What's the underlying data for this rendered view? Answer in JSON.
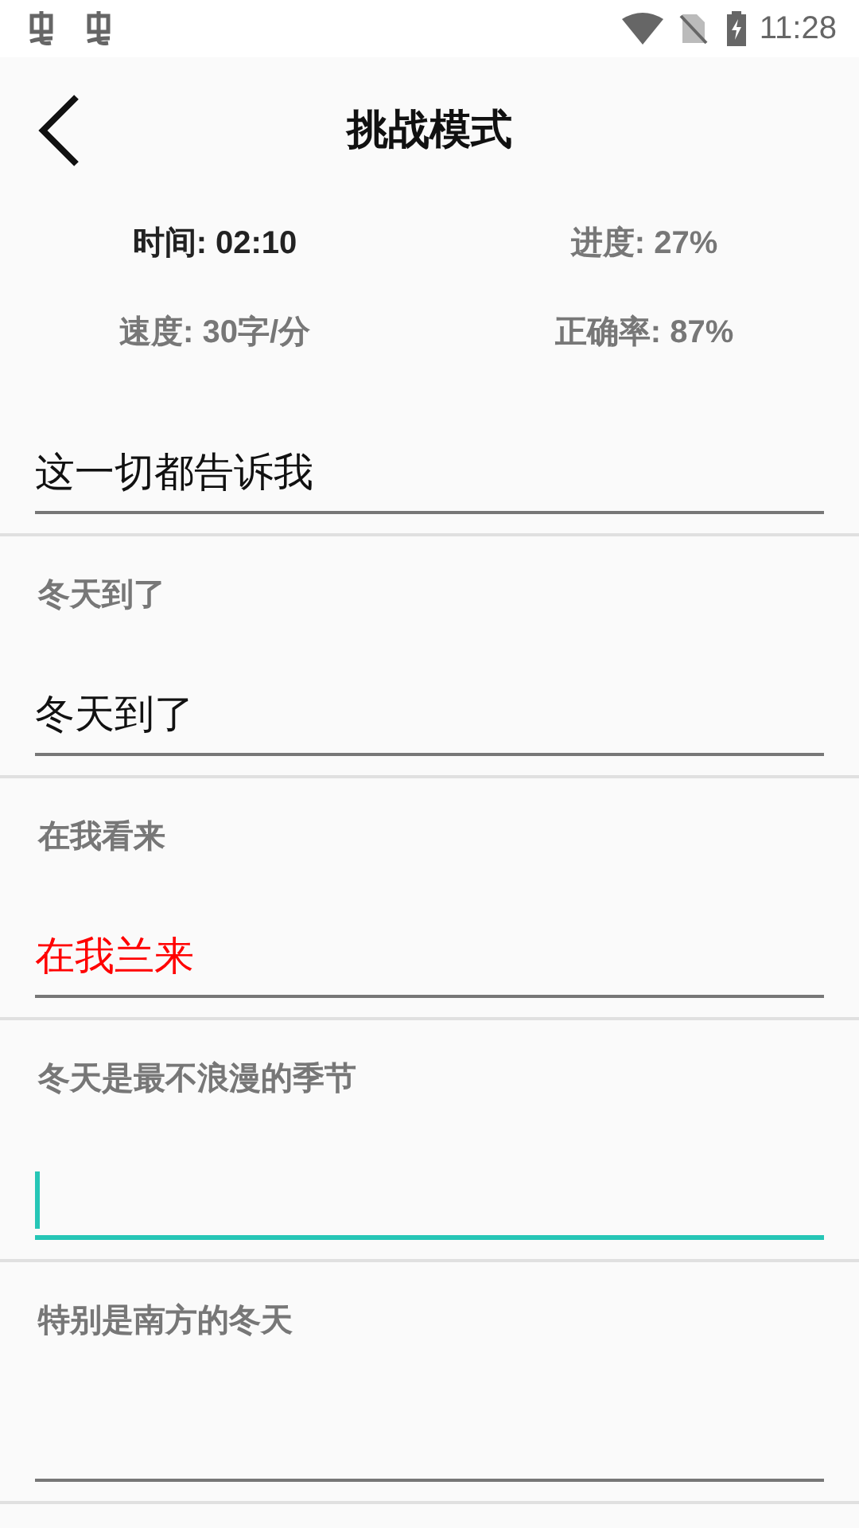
{
  "status_bar": {
    "time": "11:28"
  },
  "header": {
    "title": "挑战模式"
  },
  "stats": [
    {
      "text": "时间: 02:10",
      "emphasis": true
    },
    {
      "text": "进度: 27%",
      "emphasis": false
    },
    {
      "text": "速度: 30字/分",
      "emphasis": false
    },
    {
      "text": "正确率: 87%",
      "emphasis": false
    }
  ],
  "items": [
    {
      "value": "这一切都告诉我",
      "wrong": false,
      "focused": false
    },
    {
      "prompt": "冬天到了",
      "value": "冬天到了",
      "wrong": false,
      "focused": false
    },
    {
      "prompt": "在我看来",
      "value": "在我兰来",
      "wrong": true,
      "focused": false
    },
    {
      "prompt": "冬天是最不浪漫的季节",
      "focused": true
    },
    {
      "prompt": "特别是南方的冬天",
      "focused": false
    }
  ]
}
